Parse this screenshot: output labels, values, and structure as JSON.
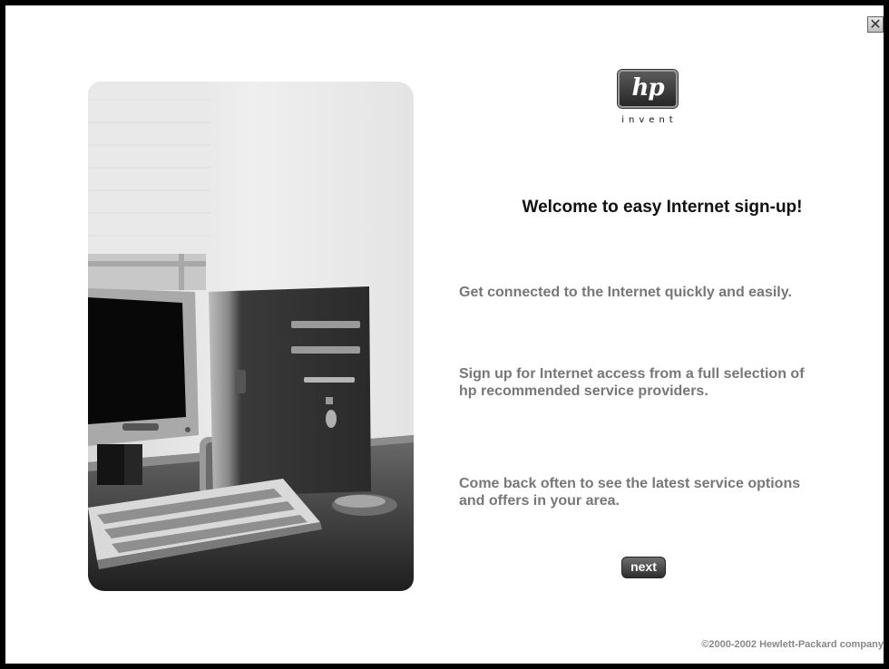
{
  "window": {
    "close_icon": "close-icon",
    "close_glyph": "✕"
  },
  "logo": {
    "mark": "hp",
    "tagline": "invent"
  },
  "content": {
    "heading": "Welcome to easy Internet sign-up!",
    "paragraphs": [
      "Get connected to the Internet quickly and easily.",
      "Sign up for Internet access from a full selection of hp recommended service providers.",
      "Come back often to see the latest service options and offers in your area."
    ],
    "next_label": "next"
  },
  "footer": {
    "copyright": "©2000-2002 Hewlett-Packard company"
  },
  "colors": {
    "heading": "#111111",
    "body_text": "#777777",
    "button": "#3a3a3a",
    "frame": "#000000"
  }
}
